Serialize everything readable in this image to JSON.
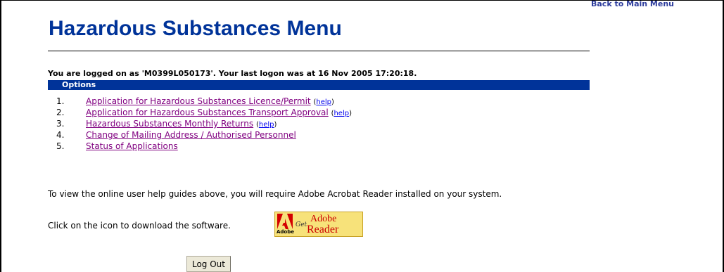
{
  "nav": {
    "back_label": "Back to Main Menu"
  },
  "page": {
    "title": "Hazardous Substances Menu"
  },
  "logon": {
    "message": "You are logged on as 'M0399L050173'. Your last logon was at 16 Nov 2005 17:20:18."
  },
  "options": {
    "header": "Options",
    "items": [
      {
        "num": "1.",
        "label": "Application for Hazardous Substances Licence/Permit",
        "help": "help"
      },
      {
        "num": "2.",
        "label": "Application for Hazardous Substances Transport Approval",
        "help": "help"
      },
      {
        "num": "3.",
        "label": "Hazardous Substances Monthly Returns",
        "help": "help"
      },
      {
        "num": "4.",
        "label": "Change of Mailing Address / Authorised Personnel"
      },
      {
        "num": "5.",
        "label": "Status of Applications"
      }
    ]
  },
  "info": {
    "line1": "To view the online user help guides above, you will require Adobe Acrobat Reader installed on your system.",
    "line2": "Click on the icon to download the software."
  },
  "adobe_badge": {
    "brand": "Adobe",
    "get": "Get",
    "word": "Adobe",
    "product": "Reader",
    "icon": "adobe-reader-icon"
  },
  "actions": {
    "logout_label": "Log Out"
  },
  "colors": {
    "title": "#003399",
    "options_bar": "#003399",
    "visited_link": "#800080",
    "help_link": "#0000ee",
    "badge": "#f7e27a"
  }
}
